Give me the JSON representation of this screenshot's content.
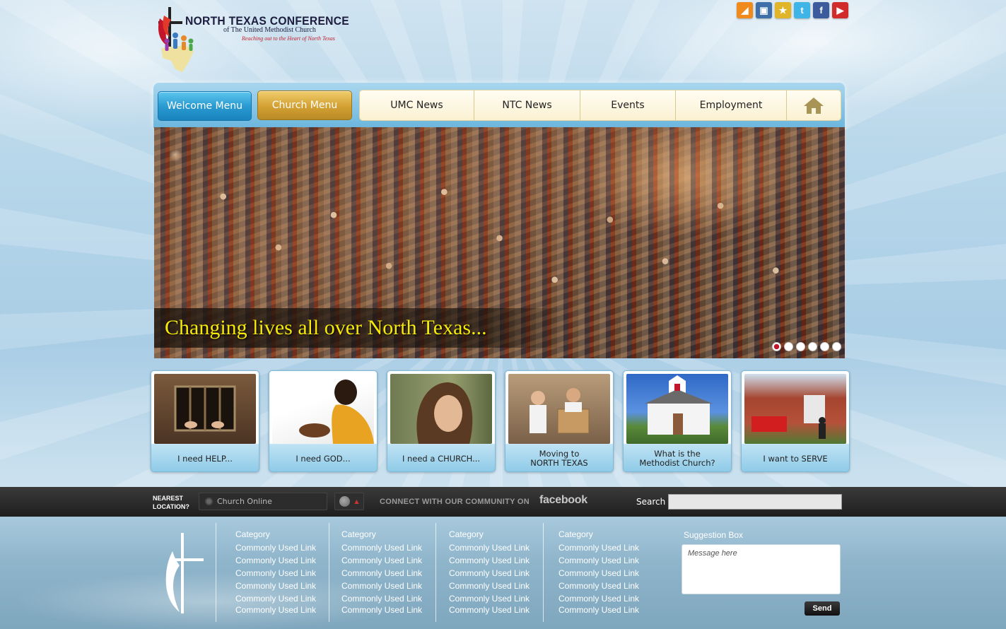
{
  "header": {
    "logo_title": "NORTH TEXAS CONFERENCE",
    "logo_subtitle": "of The United Methodist Church",
    "logo_tagline": "Reaching out to the Heart of North Texas"
  },
  "social_icons": [
    {
      "name": "rss-icon",
      "color": "#f08a1c",
      "glyph": "◢"
    },
    {
      "name": "monitor-icon",
      "color": "#3f6fa8",
      "glyph": "▣"
    },
    {
      "name": "bookmark-plus-icon",
      "color": "#e0b52a",
      "glyph": "★"
    },
    {
      "name": "twitter-icon",
      "color": "#3fb4e6",
      "glyph": "t"
    },
    {
      "name": "facebook-icon",
      "color": "#3b5b9c",
      "glyph": "f"
    },
    {
      "name": "youtube-icon",
      "color": "#d22b2b",
      "glyph": "▶"
    }
  ],
  "nav": {
    "welcome": "Welcome Menu",
    "church": "Church Menu",
    "items": [
      "UMC News",
      "NTC News",
      "Events",
      "Employment"
    ]
  },
  "hero": {
    "caption": "Changing lives all over North Texas...",
    "slides": 6,
    "active_slide": 1
  },
  "tiles": [
    {
      "label": "I need HELP..."
    },
    {
      "label": "I need GOD..."
    },
    {
      "label": "I need a CHURCH..."
    },
    {
      "label": "Moving to\nNORTH TEXAS"
    },
    {
      "label": "What is the\nMethodist Church?"
    },
    {
      "label": "I  want to SERVE"
    }
  ],
  "toolbar": {
    "nearest_label": "NEAREST\nLOCATION?",
    "location_value": "Church Online",
    "connect_text": "CONNECT WITH OUR COMMUNITY ON",
    "facebook_word": "facebook",
    "search_label": "Search"
  },
  "footer": {
    "columns": [
      {
        "category": "Category",
        "links": [
          "Commonly Used Link",
          "Commonly Used Link",
          "Commonly Used Link",
          "Commonly Used Link",
          "Commonly Used Link",
          "Commonly Used Link"
        ]
      },
      {
        "category": "Category",
        "links": [
          "Commonly Used Link",
          "Commonly Used Link",
          "Commonly Used Link",
          "Commonly Used Link",
          "Commonly Used Link",
          "Commonly Used Link"
        ]
      },
      {
        "category": "Category",
        "links": [
          "Commonly Used Link",
          "Commonly Used Link",
          "Commonly Used Link",
          "Commonly Used Link",
          "Commonly Used Link",
          "Commonly Used Link"
        ]
      },
      {
        "category": "Category",
        "links": [
          "Commonly Used Link",
          "Commonly Used Link",
          "Commonly Used Link",
          "Commonly Used Link",
          "Commonly Used Link",
          "Commonly Used Link"
        ]
      }
    ],
    "suggestion_label": "Suggestion Box",
    "suggestion_placeholder": "Message here",
    "send_label": "Send"
  },
  "colors": {
    "brand_red": "#c4162a",
    "welcome_blue": "#2a9bd1",
    "church_gold": "#d3a033",
    "caption_yellow": "#f5e90a"
  }
}
